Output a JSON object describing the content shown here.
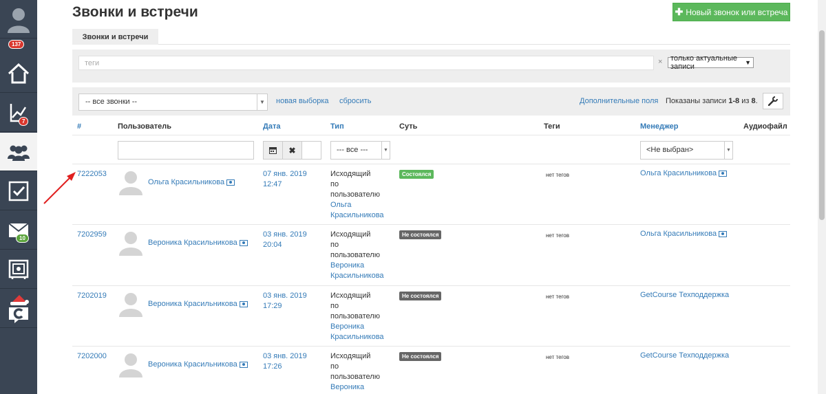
{
  "sidebar": {
    "badges": {
      "profile": "137",
      "analytics": "7",
      "mail": "10"
    }
  },
  "page": {
    "title": "Звонки и встречи"
  },
  "toolbar": {
    "new_button_label": "Новый звонок или встреча"
  },
  "tabs": [
    {
      "label": "Звонки и встречи"
    }
  ],
  "tags_filter": {
    "placeholder": "теги",
    "clear_symbol": "×",
    "scope_select": "только актуальные записи"
  },
  "filters": {
    "calls_select": "-- все звонки --",
    "new_selection": "новая выборка",
    "reset": "сбросить",
    "extra_fields": "Дополнительные поля",
    "shown_prefix": "Показаны записи ",
    "shown_range": "1-8",
    "shown_mid": " из ",
    "shown_total": "8",
    "shown_suffix": "."
  },
  "columns": {
    "id": "#",
    "user": "Пользователь",
    "date": "Дата",
    "type": "Тип",
    "essence": "Суть",
    "tags": "Теги",
    "manager": "Менеджер",
    "audio": "Аудиофайл"
  },
  "column_filters": {
    "type_select": "--- все ---",
    "manager_select": "<Не выбран>"
  },
  "rows": [
    {
      "id": "7222053",
      "user": "Ольга Красильникова",
      "date": "07 янв. 2019",
      "time": "12:47",
      "type_lines": [
        "Исходящий",
        "по",
        "пользователю"
      ],
      "type_user_lines": [
        "Ольга",
        "Красильникова"
      ],
      "status": "Состоялся",
      "tags": "нет тегов",
      "manager": "Ольга Красильникова"
    },
    {
      "id": "7202959",
      "user": "Вероника Красильникова",
      "date": "03 янв. 2019",
      "time": "20:04",
      "type_lines": [
        "Исходящий",
        "по",
        "пользователю"
      ],
      "type_user_lines": [
        "Вероника",
        "Красильникова"
      ],
      "status": "Не состоялся",
      "tags": "нет тегов",
      "manager": "Ольга Красильникова"
    },
    {
      "id": "7202019",
      "user": "Вероника Красильникова",
      "date": "03 янв. 2019",
      "time": "17:29",
      "type_lines": [
        "Исходящий",
        "по",
        "пользователю"
      ],
      "type_user_lines": [
        "Вероника",
        "Красильникова"
      ],
      "status": "Не состоялся",
      "tags": "нет тегов",
      "manager": "GetCourse Техподдержка"
    },
    {
      "id": "7202000",
      "user": "Вероника Красильникова",
      "date": "03 янв. 2019",
      "time": "17:26",
      "type_lines": [
        "Исходящий",
        "по",
        "пользователю"
      ],
      "type_user_lines": [
        "Вероника"
      ],
      "status": "Не состоялся",
      "tags": "нет тегов",
      "manager": "GetCourse Техподдержка"
    }
  ],
  "colors": {
    "sidebar": "#3a4554",
    "accent_green": "#5cb85c",
    "link": "#337ab7",
    "arrow": "#e02020"
  }
}
